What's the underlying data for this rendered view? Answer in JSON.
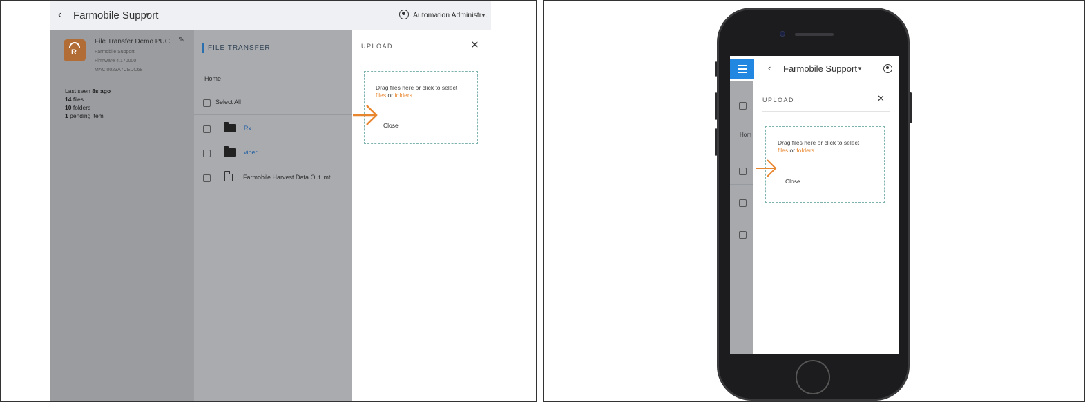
{
  "desktop": {
    "org_name": "Farmobile Support",
    "user_name": "Automation Administr...",
    "device": {
      "name": "File Transfer Demo PUC",
      "org": "Farmobile Support",
      "firmware": "Firmware 4.170000",
      "mac": "MAC 0023A7CEDC68"
    },
    "stats": {
      "last_seen_prefix": "Last seen ",
      "last_seen_value": "8s ago",
      "files_count": "14",
      "files_label": " files",
      "folders_count": "10",
      "folders_label": " folders",
      "pending_count": "1",
      "pending_label": " pending item"
    },
    "file_transfer": {
      "heading": "FILE TRANSFER",
      "breadcrumb": "Home",
      "select_all": "Select All",
      "items": [
        {
          "name": "Rx",
          "kind": "folder"
        },
        {
          "name": "viper",
          "kind": "folder"
        },
        {
          "name": "Farmobile Harvest Data Out.imt",
          "kind": "file"
        }
      ]
    },
    "upload": {
      "title": "UPLOAD",
      "drop_text_1": "Drag files here or click to select",
      "files_link": "files",
      "or_text": " or ",
      "folders_link": "folders.",
      "close_label": "Close"
    }
  },
  "mobile": {
    "org_name": "Farmobile Support",
    "breadcrumb_partial": "Hom",
    "upload": {
      "title": "UPLOAD",
      "drop_text_1": "Drag files here or click to select",
      "files_link": "files",
      "or_text": " or ",
      "folders_link": "folders.",
      "close_label": "Close"
    }
  },
  "colors": {
    "accent_orange": "#e8862f",
    "link_blue": "#2561a3",
    "menu_blue": "#2187e0",
    "dropzone_border": "#7fb3b0"
  }
}
